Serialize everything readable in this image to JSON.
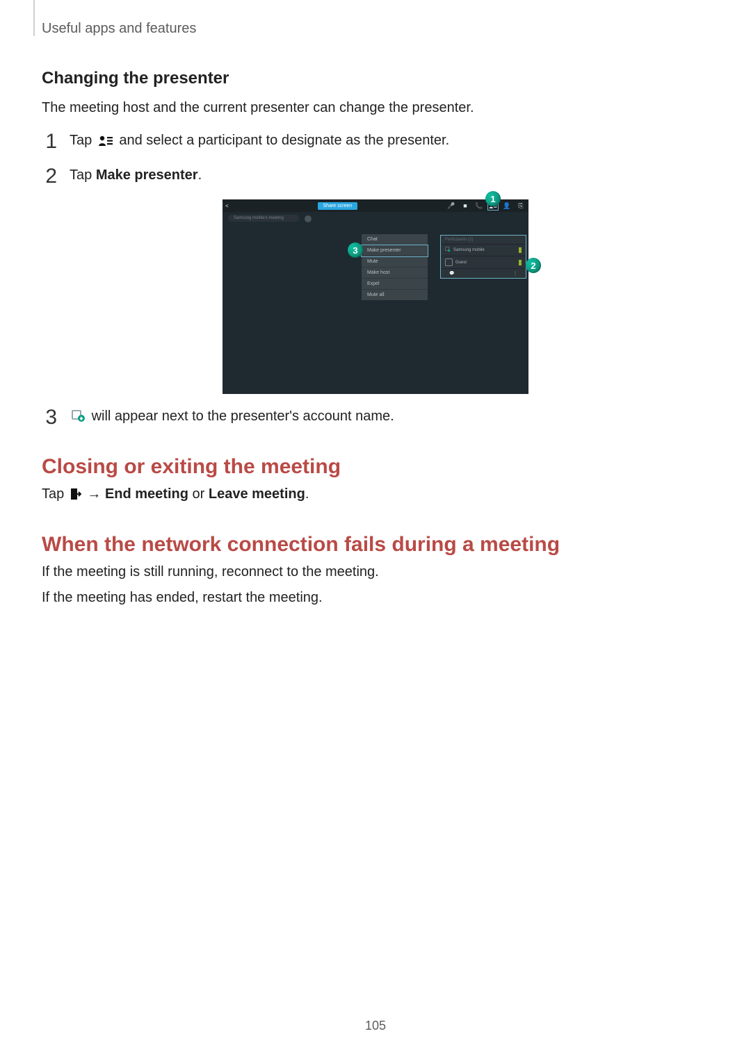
{
  "header": {
    "running_head": "Useful apps and features"
  },
  "section_changing": {
    "title": "Changing the presenter",
    "intro": "The meeting host and the current presenter can change the presenter.",
    "steps": {
      "s1": {
        "num": "1",
        "a": "Tap ",
        "b": " and select a participant to designate as the presenter."
      },
      "s2": {
        "num": "2",
        "a": "Tap ",
        "b": "Make presenter",
        "c": "."
      },
      "s3": {
        "num": "3",
        "a": " will appear next to the presenter's account name."
      }
    }
  },
  "section_closing": {
    "title": "Closing or exiting the meeting",
    "a": "Tap ",
    "b": " → ",
    "c": "End meeting",
    "d": " or ",
    "e": "Leave meeting",
    "f": "."
  },
  "section_network": {
    "title": "When the network connection fails during a meeting",
    "p1": "If the meeting is still running, reconnect to the meeting.",
    "p2": "If the meeting has ended, restart the meeting."
  },
  "page_number": "105",
  "shot": {
    "topbar_back": "<",
    "share_label": "Share screen",
    "sub_pill": "Samsung mobile's meeting",
    "menu": {
      "i0": "Chat",
      "i1": "Make presenter",
      "i2": "Mute",
      "i3": "Make host",
      "i4": "Expel",
      "i5": "Mute all"
    },
    "panel": {
      "head": "Participants (2)",
      "r0": "Samsung mobile",
      "r1": "Guest"
    },
    "callouts": {
      "c1": "1",
      "c2": "2",
      "c3": "3"
    }
  }
}
